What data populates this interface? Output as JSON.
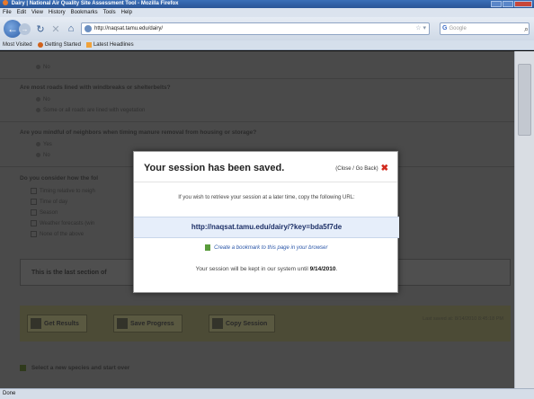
{
  "window": {
    "title": "Dairy | National Air Quality Site Assessment Tool - Mozilla Firefox"
  },
  "menu": [
    "File",
    "Edit",
    "View",
    "History",
    "Bookmarks",
    "Tools",
    "Help"
  ],
  "nav": {
    "url": "http://naqsat.tamu.edu/dairy/",
    "search_placeholder": "Google"
  },
  "bookmarks": [
    {
      "label": "Most Visited",
      "icon": "none"
    },
    {
      "label": "Getting Started",
      "icon": "firefox-icon"
    },
    {
      "label": "Latest Headlines",
      "icon": "rss-icon"
    }
  ],
  "page": {
    "q0_option": "No",
    "q1": "Are most roads lined with windbreaks or shelterbelts?",
    "q1_options": [
      "No",
      "Some or all roads are lined with vegetation"
    ],
    "q2": "Are you mindful of neighbors when timing manure removal from housing or storage?",
    "q2_options": [
      "Yes",
      "No"
    ],
    "q3": "Do you consider how the fol",
    "q3_options": [
      "Timing relative to neigh",
      "Time of day",
      "Season",
      "Weather forecasts (win",
      "None of the above"
    ],
    "last_section": "This is the last section of",
    "buttons": {
      "get_results": "Get Results",
      "save_progress": "Save Progress",
      "copy_session": "Copy Session"
    },
    "last_saved": "Last saved at: 8/14/2010 8:45:18 PM",
    "new_species": "Select a new species and start over"
  },
  "modal": {
    "title": "Your session has been saved.",
    "close_label": "(Close / Go Back)",
    "instructions": "If you wish to retrieve your session at a later time, copy the following URL:",
    "session_url": "http://naqsat.tamu.edu/dairy/?key=bda5f7de",
    "bookmark_link": "Create a bookmark to this page in your browser",
    "kept_prefix": "Your session will be kept in our system until",
    "kept_date": "9/14/2010",
    "kept_suffix": "."
  },
  "status": "Done"
}
